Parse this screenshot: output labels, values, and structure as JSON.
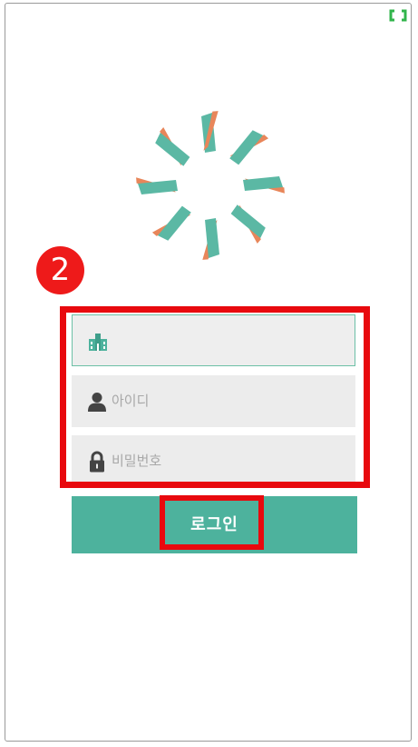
{
  "badge": {
    "step_number": "2"
  },
  "form": {
    "school": {
      "value": "",
      "placeholder": "",
      "icon": "school-building-icon"
    },
    "userid": {
      "value": "",
      "placeholder": "아이디",
      "icon": "user-icon"
    },
    "password": {
      "value": "",
      "placeholder": "비밀번호",
      "icon": "lock-icon"
    },
    "login_label": "로그인"
  },
  "colors": {
    "accent_green": "#4db29d",
    "logo_teal": "#5bb8a4",
    "logo_orange": "#e8865a",
    "highlight_red": "#e8090e",
    "field_bg": "#ececec"
  },
  "icons": {
    "expand": "expand-icon",
    "logo": "app-logo"
  }
}
